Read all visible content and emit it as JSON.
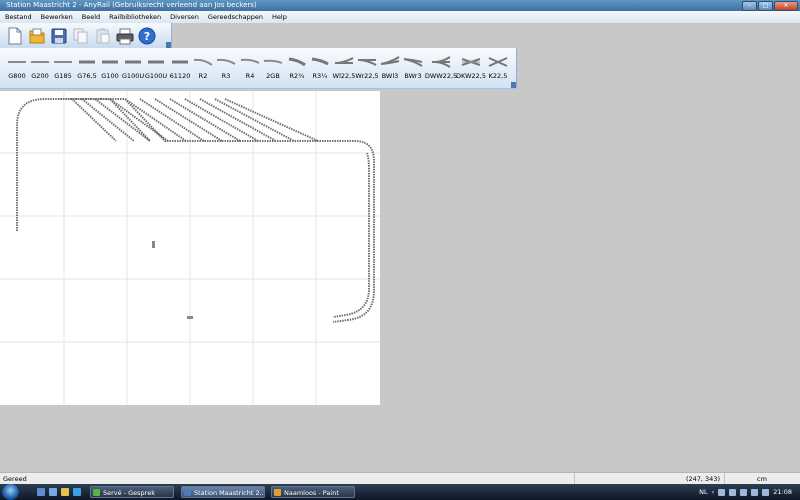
{
  "window": {
    "title": "Station Maastricht 2 - AnyRail (Gebruiksrecht verleend aan Jos beckers)"
  },
  "window_buttons": {
    "minimize": "–",
    "maximize": "□",
    "close": "✕"
  },
  "menu": [
    "Bestand",
    "Bewerken",
    "Beeld",
    "Railbibliotheken",
    "Diversen",
    "Gereedschappen",
    "Help"
  ],
  "toolbar": {
    "buttons": [
      "new-file",
      "open-folder",
      "save",
      "copy",
      "paste",
      "print",
      "help"
    ]
  },
  "rails": [
    "G800",
    "G200",
    "G185",
    "G76,5",
    "G100",
    "G100U",
    "G100U",
    "61120",
    "R2",
    "R3",
    "R4",
    "2GB",
    "R2¾",
    "R3¼",
    "Wl22,5",
    "Wr22,5",
    "BWl3",
    "BWr3",
    "DWW22,5",
    "DKW22,5",
    "K22,5"
  ],
  "status": {
    "text": "Gereed",
    "coords": "(247, 343)",
    "unit": "cm"
  },
  "taskbar": {
    "tasks": [
      "Servé - Gesprek",
      "Station Maastricht 2...",
      "Naamloos - Paint"
    ],
    "lang": "NL",
    "clock": "21:08"
  },
  "colors": {
    "canvas": "#ffffff",
    "workspace": "#c8c8c8",
    "track": "#707070",
    "titlebar": "#3d6f9f"
  }
}
